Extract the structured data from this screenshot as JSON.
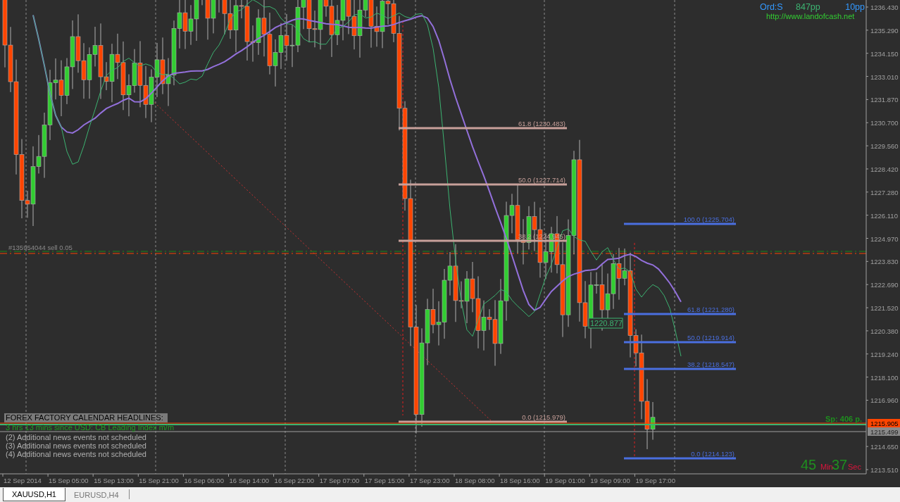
{
  "chart_info": {
    "order": "Ord:S",
    "pips": "847pp",
    "spread_setting": "10pp",
    "website": "http://www.landofcash.net"
  },
  "price_axis": {
    "ticks": [
      "1236.430",
      "1235.290",
      "1234.150",
      "1233.010",
      "1231.870",
      "1230.700",
      "1229.560",
      "1228.420",
      "1227.280",
      "1226.110",
      "1224.970",
      "1223.830",
      "1222.690",
      "1221.520",
      "1220.380",
      "1219.240",
      "1218.100",
      "1216.960",
      "1214.650",
      "1213.510"
    ],
    "current_price": "1215.905",
    "line_price": "1215.499"
  },
  "time_axis": {
    "labels": [
      "12 Sep 2014",
      "15 Sep 05:00",
      "15 Sep 13:00",
      "15 Sep 21:00",
      "16 Sep 06:00",
      "16 Sep 14:00",
      "16 Sep 22:00",
      "17 Sep 07:00",
      "17 Sep 15:00",
      "17 Sep 23:00",
      "18 Sep 08:00",
      "18 Sep 16:00",
      "19 Sep 01:00",
      "19 Sep 09:00",
      "19 Sep 17:00"
    ]
  },
  "fibonacci": [
    {
      "color": "#c8a09a",
      "levels": [
        "61.8 (1230.483)",
        "50.0 (1227.714)",
        "38.2 (1224.945)",
        "0.0 (1215.979)"
      ]
    },
    {
      "color": "#4a6fe0",
      "levels": [
        "100.0 (1225.704)",
        "61.8 (1221.280)",
        "50.0 (1219.914)",
        "38.2 (1218.547)",
        "0.0 (1214.123)"
      ]
    }
  ],
  "order_label": "#135954044 sell 0.05",
  "price_marker": "1220.877",
  "spread_label": "Sp: 406 p.",
  "news": {
    "title": "FOREX FACTORY CALENDAR HEADLINES:",
    "latest": "3 hrs 13 mins since USD: CB Leading Index m/m",
    "items": [
      "(2) Additional news events not scheduled",
      "(3) Additional news events not scheduled",
      "(4) Additional news events not scheduled"
    ]
  },
  "timer": {
    "minutes": "45",
    "min_unit": "Min",
    "seconds": "37",
    "sec_unit": "Sec"
  },
  "tabs": [
    {
      "label": "XAUUSD,H1",
      "selected": true
    },
    {
      "label": "EURUSD,H4",
      "selected": false
    }
  ]
}
